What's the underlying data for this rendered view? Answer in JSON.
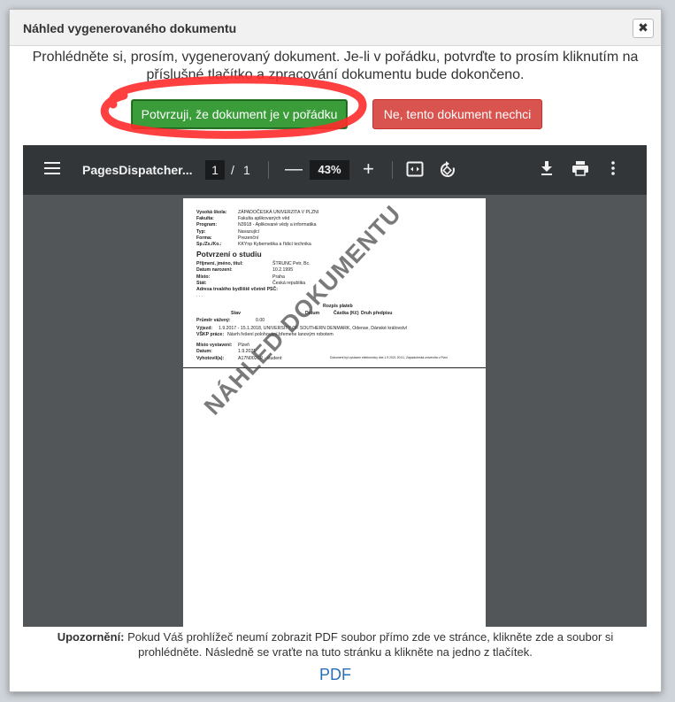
{
  "dialog": {
    "title": "Náhled vygenerovaného dokumentu",
    "close_icon": "close-icon",
    "intro": "Prohlédněte si, prosím, vygenerovaný dokument. Je-li v pořádku, potvrďte to prosím kliknutím na příslušné tlačítko a zpracování dokumentu bude dokončeno.",
    "confirm_label": "Potvrzuji, že dokument je v pořádku",
    "reject_label": "Ne, tento dokument nechci",
    "warning_label": "Upozornění:",
    "warning_text": " Pokud Váš prohlížeč neumí zobrazit PDF soubor přímo zde ve stránce, klikněte zde a soubor si prohlédněte. Následně se vraťte na tuto stránku a klikněte na jedno z tlačítek.",
    "pdf_link": "PDF"
  },
  "viewer": {
    "doc_name": "PagesDispatcher...",
    "page_current": "1",
    "page_sep": "/",
    "page_total": "1",
    "zoom": "43%",
    "minus": "—",
    "plus": "+"
  },
  "document": {
    "school_label": "Vysoká škola:",
    "school": "ZÁPADOČESKÁ UNIVERZITA V PLZNI",
    "faculty_label": "Fakulta:",
    "faculty": "Fakulta aplikovaných věd",
    "program_label": "Program:",
    "program": "N3918 - Aplikované vědy a informatika",
    "type_label": "Typ:",
    "type": "Navazující",
    "form_label": "Forma:",
    "form": "Prezenční",
    "field_label": "Sp./Zs./Ko.:",
    "field": "KKYnp Kybernetika a řídicí technika",
    "heading": "Potvrzení o studiu",
    "name_label": "Příjmení, jméno, titul:",
    "name": "ŠTRUNC Petr, Bc.",
    "birth_label": "Datum narození:",
    "birth": "10.2.1995",
    "place_label": "Místo:",
    "place": "Praha",
    "state_label": "Stát:",
    "state": "Česká republika",
    "address_label": "Adresa trvalého bydliště včetně PSČ:",
    "address_dots": ". . .",
    "payments_title": "Rozpis plateb",
    "col_state": "Stav",
    "col_date": "Datum",
    "col_amount": "Částka (Kč)",
    "col_type": "Druh předpisu",
    "avg_label": "Průměr vážený:",
    "avg": "0.00",
    "exit_label": "Výjezd:",
    "exit": "1.9.2017 - 15.1.2018, UNIVERSITY OF SOUTHERN DENMARK, Odense, Dánské království",
    "thesis_label": "VŠKP práce:",
    "thesis": "Návrh řešení polohování břemene lanovým robotem",
    "issue_place_label": "Místo vystavení:",
    "issue_place": "Plzeň",
    "date_label": "Datum:",
    "date": "1.9.2021",
    "issuer_label": "Vyhotovil(a):",
    "issuer": "A17N0020P - student",
    "footer_note": "Dokument byl vystaven elektronicky dne 1.9.2021 20:01, Západočeská univerzita v Plzni",
    "watermark": "NÁHLED DOKUMENTU"
  },
  "colors": {
    "confirm": "#3a9d3a",
    "reject": "#d9534f",
    "annotation": "#ff2b2b",
    "link": "#2a6fb5"
  }
}
